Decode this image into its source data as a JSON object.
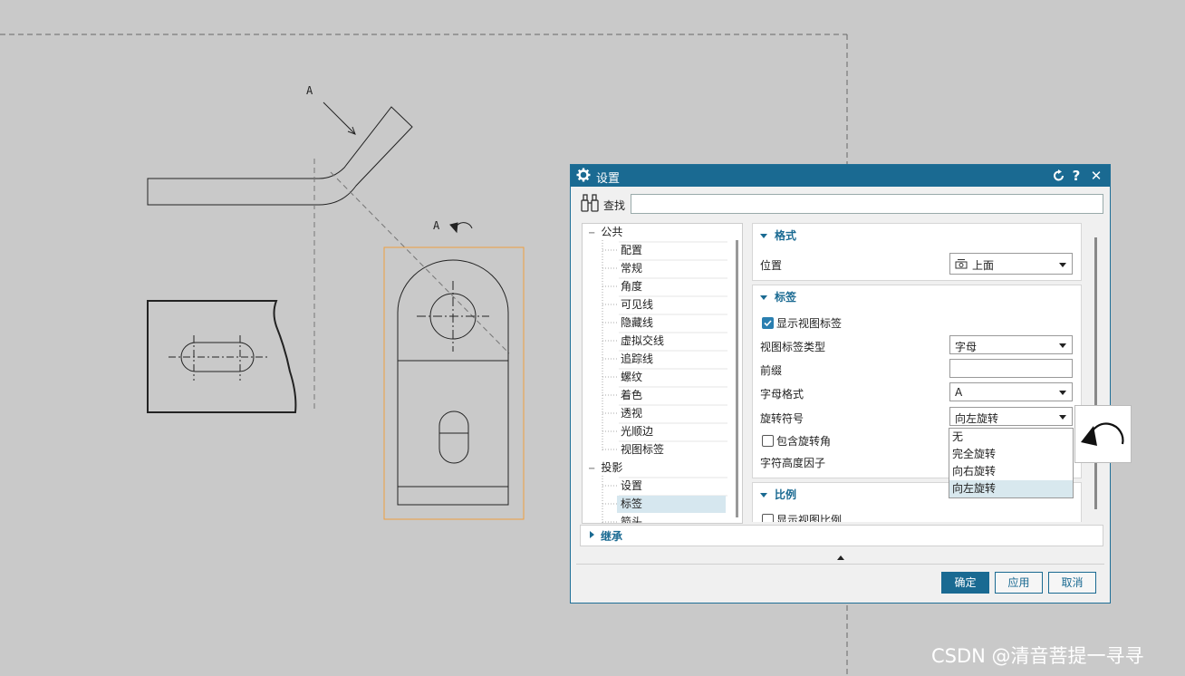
{
  "drawing": {
    "label_a_top": "A",
    "label_a_view": "A"
  },
  "dialog": {
    "title": "设置",
    "search_label": "查找",
    "search_value": "",
    "tree": [
      {
        "label": "公共",
        "level": 0,
        "expander": "−"
      },
      {
        "label": "配置",
        "level": 1
      },
      {
        "label": "常规",
        "level": 1
      },
      {
        "label": "角度",
        "level": 1
      },
      {
        "label": "可见线",
        "level": 1
      },
      {
        "label": "隐藏线",
        "level": 1
      },
      {
        "label": "虚拟交线",
        "level": 1
      },
      {
        "label": "追踪线",
        "level": 1
      },
      {
        "label": "螺纹",
        "level": 1
      },
      {
        "label": "着色",
        "level": 1
      },
      {
        "label": "透视",
        "level": 1
      },
      {
        "label": "光顺边",
        "level": 1
      },
      {
        "label": "视图标签",
        "level": 1
      },
      {
        "label": "投影",
        "level": 0,
        "expander": "−"
      },
      {
        "label": "设置",
        "level": 1
      },
      {
        "label": "标签",
        "level": 1,
        "selected": true
      },
      {
        "label": "箭头",
        "level": 1
      }
    ],
    "groups": {
      "format": {
        "title": "格式",
        "position_label": "位置",
        "position_value": "上面"
      },
      "label": {
        "title": "标签",
        "show_view_label": "显示视图标签",
        "show_view_label_checked": true,
        "label_type_label": "视图标签类型",
        "label_type_value": "字母",
        "prefix_label": "前缀",
        "prefix_value": "",
        "letter_format_label": "字母格式",
        "letter_format_value": "A",
        "rotation_symbol_label": "旋转符号",
        "rotation_symbol_value": "向左旋转",
        "include_rotation_angle": "包含旋转角",
        "include_rotation_angle_checked": false,
        "char_height_factor_label": "字符高度因子"
      },
      "scale": {
        "title": "比例",
        "show_view_scale": "显示视图比例"
      }
    },
    "rotation_options": [
      "无",
      "完全旋转",
      "向右旋转",
      "向左旋转"
    ],
    "rotation_highlighted": "向左旋转",
    "inherit_title": "继承",
    "buttons": {
      "ok": "确定",
      "apply": "应用",
      "cancel": "取消"
    }
  },
  "watermark": "CSDN @清音菩提一寻寻",
  "colors": {
    "title_bar": "#1a6a92",
    "selection_frame": "#f0a040",
    "highlight": "#d8e8ee"
  }
}
